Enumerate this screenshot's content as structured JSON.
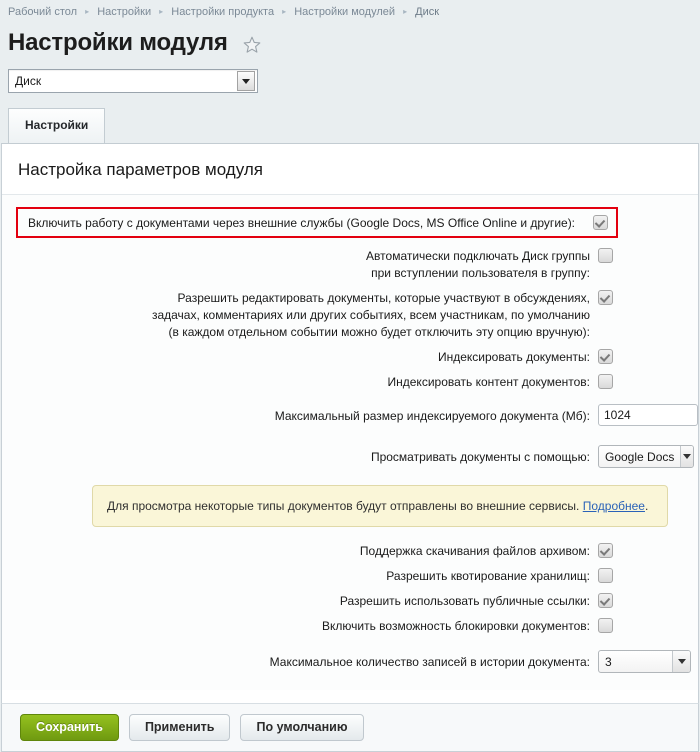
{
  "breadcrumb": {
    "items": [
      {
        "label": "Рабочий стол"
      },
      {
        "label": "Настройки"
      },
      {
        "label": "Настройки продукта"
      },
      {
        "label": "Настройки модулей"
      },
      {
        "label": "Диск"
      }
    ],
    "separator": "▸"
  },
  "header": {
    "title": "Настройки модуля",
    "favorite_icon": "star-icon"
  },
  "module_select": {
    "value": "Диск"
  },
  "tabs": [
    {
      "label": "Настройки",
      "active": true
    }
  ],
  "content": {
    "title": "Настройка параметров модуля"
  },
  "settings": {
    "highlighted": {
      "label": "Включить работу с документами через внешние службы (Google Docs, MS Office Online и другие):",
      "checked": true,
      "highlight_color": "#e3000f"
    },
    "rows": [
      {
        "label": "Автоматически подключать Диск группы\nпри вступлении пользователя в группу:",
        "type": "checkbox",
        "checked": false
      },
      {
        "label": "Разрешить редактировать документы, которые участвуют в обсуждениях,\nзадачах, комментариях или других событиях, всем участникам, по умолчанию\n(в каждом отдельном событии можно будет отключить эту опцию вручную):",
        "type": "checkbox",
        "checked": true
      },
      {
        "label": "Индексировать документы:",
        "type": "checkbox",
        "checked": true
      },
      {
        "label": "Индексировать контент документов:",
        "type": "checkbox",
        "checked": false
      },
      {
        "label": "Максимальный размер индексируемого документа (Мб):",
        "type": "text",
        "value": "1024"
      },
      {
        "label": "Просматривать документы с помощью:",
        "type": "select",
        "value": "Google Docs"
      }
    ],
    "notice": {
      "text": "Для просмотра некоторые типы документов будут отправлены во внешние сервисы.",
      "link_label": "Подробнее",
      "trailing": "."
    },
    "rows2": [
      {
        "label": "Поддержка скачивания файлов архивом:",
        "type": "checkbox",
        "checked": true
      },
      {
        "label": "Разрешить квотирование хранилищ:",
        "type": "checkbox",
        "checked": false
      },
      {
        "label": "Разрешить использовать публичные ссылки:",
        "type": "checkbox",
        "checked": true
      },
      {
        "label": "Включить возможность блокировки документов:",
        "type": "checkbox",
        "checked": false
      },
      {
        "label": "Максимальное количество записей в истории документа:",
        "type": "select",
        "value": "3"
      }
    ]
  },
  "footer": {
    "save_label": "Сохранить",
    "apply_label": "Применить",
    "default_label": "По умолчанию"
  }
}
